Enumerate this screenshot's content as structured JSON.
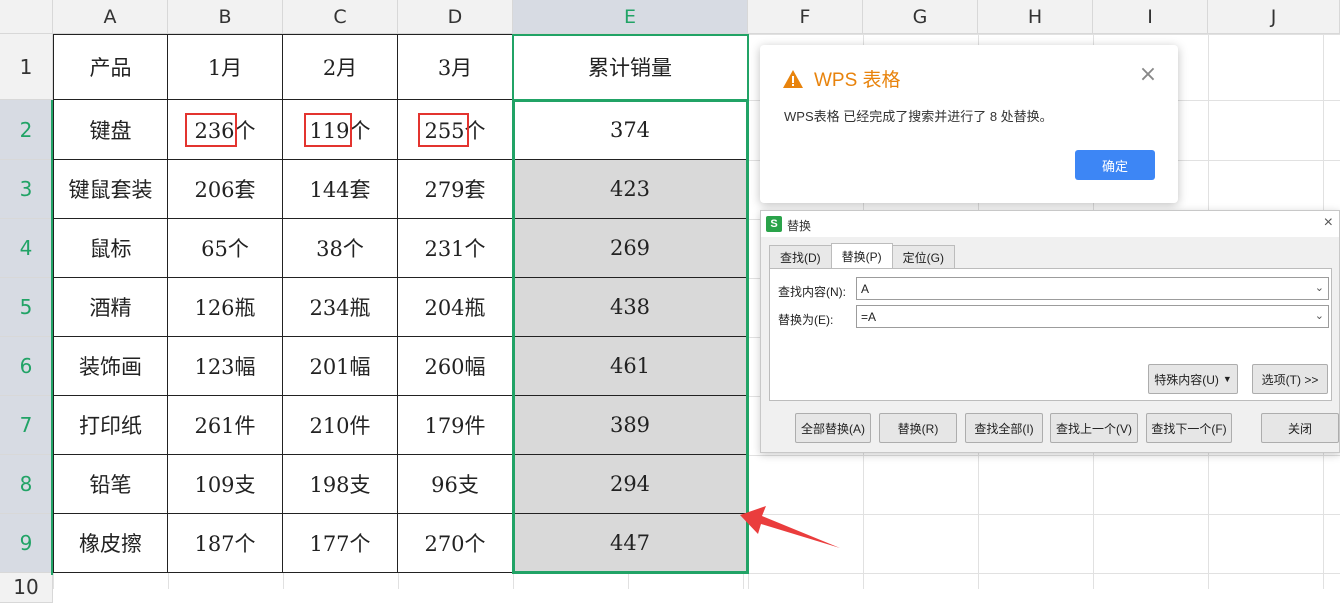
{
  "columns": [
    "A",
    "B",
    "C",
    "D",
    "E",
    "F",
    "G",
    "H",
    "I",
    "J"
  ],
  "rows": [
    "1",
    "2",
    "3",
    "4",
    "5",
    "6",
    "7",
    "8",
    "9",
    "10"
  ],
  "header_row": [
    "产品",
    "1月",
    "2月",
    "3月",
    "累计销量"
  ],
  "table": [
    [
      "键盘",
      "236个",
      "119个",
      "255个",
      "374"
    ],
    [
      "键鼠套装",
      "206套",
      "144套",
      "279套",
      "423"
    ],
    [
      "鼠标",
      "65个",
      "38个",
      "231个",
      "269"
    ],
    [
      "酒精",
      "126瓶",
      "234瓶",
      "204瓶",
      "438"
    ],
    [
      "装饰画",
      "123幅",
      "201幅",
      "260幅",
      "461"
    ],
    [
      "打印纸",
      "261件",
      "210件",
      "179件",
      "389"
    ],
    [
      "铅笔",
      "109支",
      "198支",
      "96支",
      "294"
    ],
    [
      "橡皮擦",
      "187个",
      "177个",
      "270个",
      "447"
    ]
  ],
  "message": {
    "title": "WPS 表格",
    "text": "WPS表格 已经完成了搜索并进行了 8 处替换。",
    "ok_label": "确定",
    "close_icon": "×"
  },
  "replace_dialog": {
    "title": "替换",
    "app_icon_letter": "S",
    "close_icon": "×",
    "tabs": [
      "查找(D)",
      "替换(P)",
      "定位(G)"
    ],
    "find_label": "查找内容(N):",
    "find_value": "A",
    "replace_label": "替换为(E):",
    "replace_value": "=A",
    "special_label": "特殊内容(U)",
    "options_label": "选项(T) >>",
    "buttons": [
      "全部替换(A)",
      "替换(R)",
      "查找全部(I)",
      "查找上一个(V)",
      "查找下一个(F)",
      "关闭"
    ]
  },
  "colors": {
    "accent": "#21a366",
    "warning": "#e8830c",
    "primary": "#3d86f5",
    "highlight": "#e3342f"
  }
}
